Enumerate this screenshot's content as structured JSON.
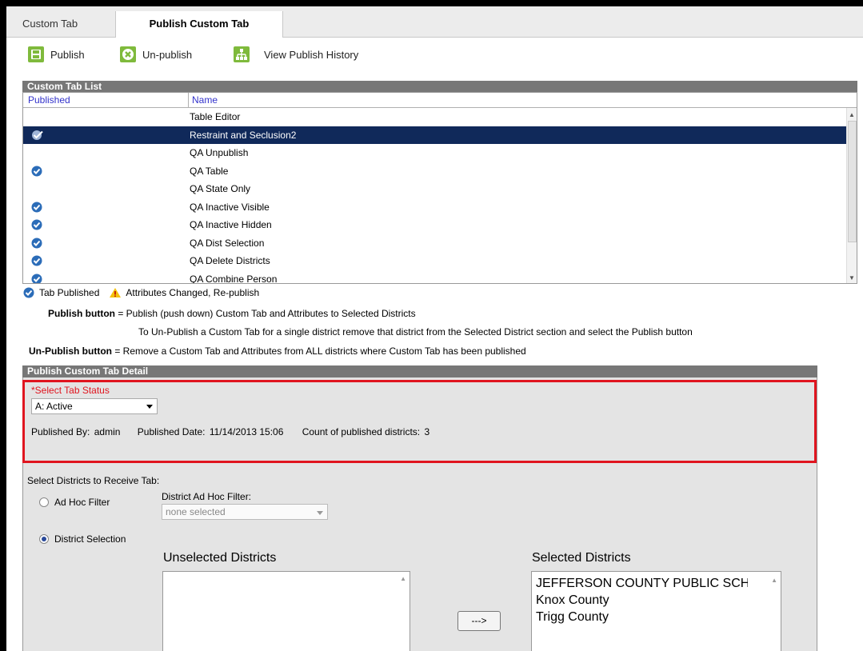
{
  "tabs": [
    {
      "label": "Custom Tab"
    },
    {
      "label": "Publish Custom Tab"
    }
  ],
  "toolbar": {
    "publish_label": "Publish",
    "unpublish_label": "Un-publish",
    "history_label": "View Publish History"
  },
  "list": {
    "header": "Custom Tab List",
    "columns": {
      "published": "Published",
      "name": "Name"
    },
    "rows": [
      {
        "name": "Table Editor",
        "published": false
      },
      {
        "name": "Restraint and Seclusion2",
        "published": true,
        "selected": true
      },
      {
        "name": "QA Unpublish",
        "published": false
      },
      {
        "name": "QA Table",
        "published": true
      },
      {
        "name": "QA State Only",
        "published": false
      },
      {
        "name": "QA Inactive Visible",
        "published": true
      },
      {
        "name": "QA Inactive Hidden",
        "published": true
      },
      {
        "name": "QA Dist Selection",
        "published": true
      },
      {
        "name": "QA Delete Districts",
        "published": true
      },
      {
        "name": "QA Combine Person",
        "published": true
      }
    ]
  },
  "legend": {
    "tab_published": "Tab Published",
    "attributes_changed": "Attributes Changed, Re-publish"
  },
  "help": {
    "publish_btn_label": "Publish button",
    "publish_btn_text": " = Publish (push down) Custom Tab and Attributes to Selected Districts",
    "unpublish_single_text": "To Un-Publish a Custom Tab for a single district remove that district from the Selected District section and select the Publish button",
    "unpublish_btn_label": "Un-Publish button",
    "unpublish_btn_text": " = Remove a Custom Tab and Attributes from ALL districts where Custom Tab has been published"
  },
  "detail": {
    "header": "Publish Custom Tab Detail",
    "status_label": "*Select Tab Status",
    "status_value": "A: Active",
    "published_by_label": "Published By:",
    "published_by_value": "admin",
    "published_date_label": "Published Date:",
    "published_date_value": "11/14/2013 15:06",
    "count_label": "Count of published districts:",
    "count_value": "3",
    "select_districts_label": "Select Districts to Receive Tab:",
    "adhoc_radio_label": "Ad Hoc Filter",
    "adhoc_filter_label": "District Ad Hoc Filter:",
    "adhoc_filter_placeholder": "none selected",
    "district_radio_label": "District Selection",
    "unselected_title": "Unselected Districts",
    "selected_title": "Selected Districts",
    "move_button": "--->",
    "selected_districts": [
      "JEFFERSON COUNTY PUBLIC SCHOOLS",
      "Knox County",
      "Trigg County"
    ]
  },
  "colors": {
    "accent_green": "#7fba3c",
    "selected_row": "#10295a",
    "header_gray": "#777777",
    "highlight_red": "#e0151f",
    "check_blue": "#2b6cb8"
  }
}
